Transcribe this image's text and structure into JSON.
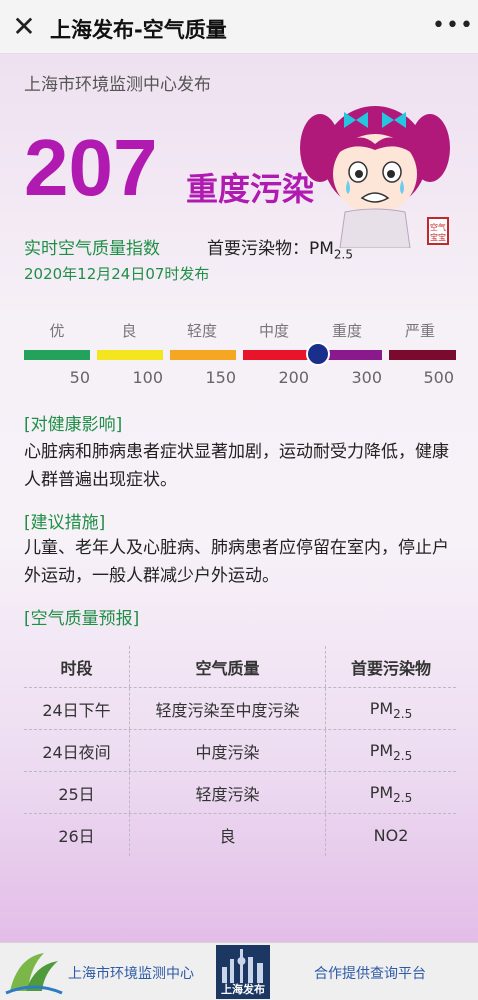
{
  "topbar": {
    "title": "上海发布-空气质量",
    "close_icon": "close-icon",
    "more_icon": "more-icon"
  },
  "header": {
    "source": "上海市环境监测中心发布",
    "aqi_value": "207",
    "aqi_level": "重度污染",
    "mascot_stamp": "空气宝宝",
    "realtime_label": "实时空气质量指数",
    "pollutant_prefix": "首要污染物：PM",
    "pollutant_sub": "2.5",
    "time": "2020年12月24日07时发布"
  },
  "scale": {
    "aqi_marker_value": 207,
    "levels": [
      {
        "label": "优",
        "color": "#23a25c",
        "upper": "50"
      },
      {
        "label": "良",
        "color": "#f5e51f",
        "upper": "100"
      },
      {
        "label": "轻度",
        "color": "#f5a623",
        "upper": "150"
      },
      {
        "label": "中度",
        "color": "#e8152a",
        "upper": "200"
      },
      {
        "label": "重度",
        "color": "#8a1a8c",
        "upper": "300"
      },
      {
        "label": "严重",
        "color": "#7a0b2e",
        "upper": "500"
      }
    ]
  },
  "health": {
    "title": "[对健康影响]",
    "text": "心脏病和肺病患者症状显著加剧，运动耐受力降低，健康人群普遍出现症状。"
  },
  "advice": {
    "title": "[建议措施]",
    "text": "儿童、老年人及心脏病、肺病患者应停留在室内，停止户外运动，一般人群减少户外运动。"
  },
  "forecast": {
    "title": "[空气质量预报]",
    "headers": [
      "时段",
      "空气质量",
      "首要污染物"
    ],
    "rows": [
      {
        "period": "24日下午",
        "quality": "轻度污染至中度污染",
        "pollutant": "PM",
        "sub": "2.5"
      },
      {
        "period": "24日夜间",
        "quality": "中度污染",
        "pollutant": "PM",
        "sub": "2.5"
      },
      {
        "period": "25日",
        "quality": "轻度污染",
        "pollutant": "PM",
        "sub": "2.5"
      },
      {
        "period": "26日",
        "quality": "良",
        "pollutant": "NO2",
        "sub": ""
      }
    ]
  },
  "footer": {
    "org": "上海市环境监测中心",
    "brand": "上海发布",
    "link": "合作提供查询平台"
  }
}
